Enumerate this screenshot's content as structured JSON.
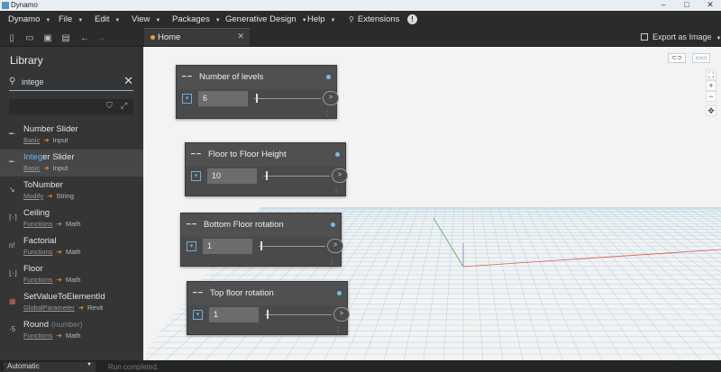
{
  "window": {
    "title": "Dynamo",
    "minimize": "–",
    "maximize": "□",
    "close": "✕"
  },
  "menus": [
    {
      "label": "Dynamo"
    },
    {
      "label": "File"
    },
    {
      "label": "Edit"
    },
    {
      "label": "View"
    },
    {
      "label": "Packages"
    },
    {
      "label": "Generative Design"
    },
    {
      "label": "Help"
    }
  ],
  "extensions_label": "Extensions",
  "tab": {
    "label": "Home"
  },
  "export_label": "Export as Image",
  "library": {
    "title": "Library",
    "search_value": "intege",
    "items": [
      {
        "name": "Number Slider",
        "name_hl": "",
        "name_rest": "Number Slider",
        "sub": "",
        "category": "Basic",
        "group": "Input"
      },
      {
        "name": "Integer Slider",
        "name_hl": "Integ",
        "name_rest": "er Slider",
        "sub": "",
        "category": "Basic",
        "group": "Input"
      },
      {
        "name": "ToNumber",
        "name_hl": "",
        "name_rest": "ToNumber",
        "sub": "",
        "category": "Modify",
        "group": "String"
      },
      {
        "name": "Ceiling",
        "name_hl": "",
        "name_rest": "Ceiling",
        "sub": "",
        "category": "Functions",
        "group": "Math"
      },
      {
        "name": "Factorial",
        "name_hl": "",
        "name_rest": "Factorial",
        "sub": "",
        "category": "Functions",
        "group": "Math"
      },
      {
        "name": "Floor",
        "name_hl": "",
        "name_rest": "Floor",
        "sub": "",
        "category": "Functions",
        "group": "Math"
      },
      {
        "name": "SetValueToElementId",
        "name_hl": "",
        "name_rest": "SetValueToElementId",
        "sub": "",
        "category": "GlobalParameter",
        "group": "Revit"
      },
      {
        "name": "Round",
        "name_hl": "",
        "name_rest": "Round",
        "sub": "(number)",
        "category": "Functions",
        "group": "Math"
      }
    ]
  },
  "nodes": [
    {
      "title": "Number of levels",
      "value": "6",
      "out": ">"
    },
    {
      "title": "Floor to Floor Height",
      "value": "10",
      "out": ">"
    },
    {
      "title": "Bottom Floor rotation",
      "value": "1",
      "out": ">"
    },
    {
      "title": "Top floor rotation",
      "value": "1",
      "out": ">"
    }
  ],
  "status": {
    "run_mode": "Automatic",
    "run_status": "Run completed."
  },
  "colors": {
    "accent": "#6ac1f0",
    "tab_dot": "#f0a030",
    "grid": "#b9d6e6",
    "axis_x": "#e25555",
    "axis_y": "#55aa55"
  }
}
